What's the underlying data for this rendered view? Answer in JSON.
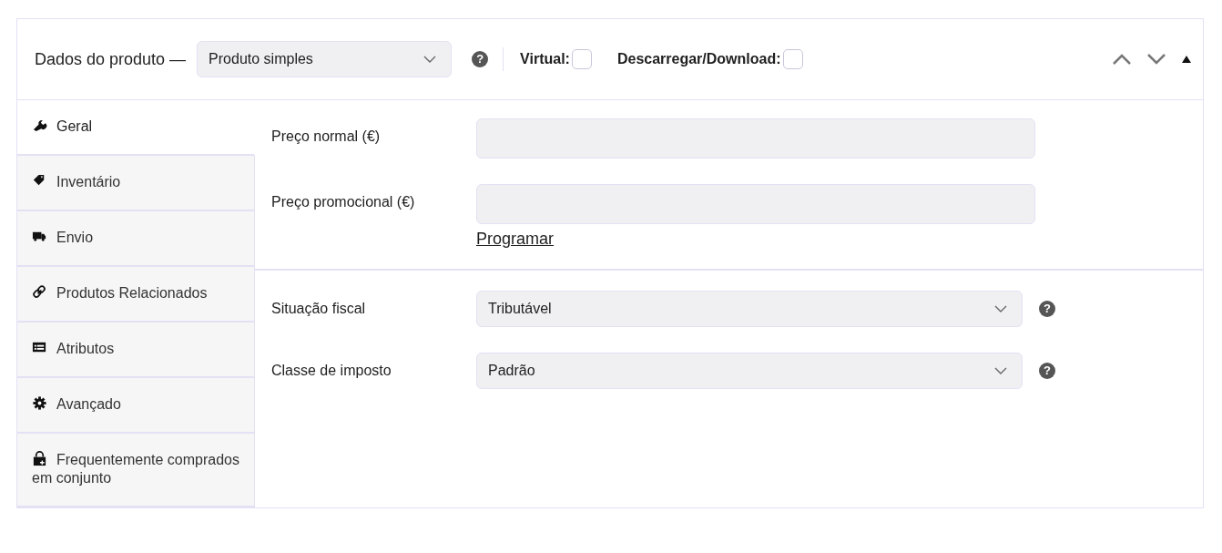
{
  "header": {
    "title": "Dados do produto —",
    "product_type": "Produto simples",
    "help": "?",
    "options": [
      {
        "label": "Virtual:",
        "checked": false
      },
      {
        "label": "Descarregar/Download:",
        "checked": false
      }
    ]
  },
  "tabs": [
    {
      "label": "Geral",
      "selected": true
    },
    {
      "label": "Inventário",
      "selected": false
    },
    {
      "label": "Envio",
      "selected": false
    },
    {
      "label": "Produtos Relacionados",
      "selected": false
    },
    {
      "label": "Atributos",
      "selected": false
    },
    {
      "label": "Avançado",
      "selected": false
    },
    {
      "label": "Frequentemente comprados em conjunto",
      "selected": false
    }
  ],
  "pricing": {
    "fields": [
      {
        "label": "Preço normal (€)",
        "kind": "input"
      },
      {
        "label": "Preço promocional (€)",
        "kind": "input"
      }
    ],
    "schedule_link": "Programar"
  },
  "tax": {
    "fields": [
      {
        "label": "Situação fiscal",
        "kind": "select",
        "value": "Tributável",
        "help": "?"
      },
      {
        "label": "Classe de imposto",
        "kind": "select",
        "value": "Padrão",
        "help": "?"
      }
    ]
  }
}
